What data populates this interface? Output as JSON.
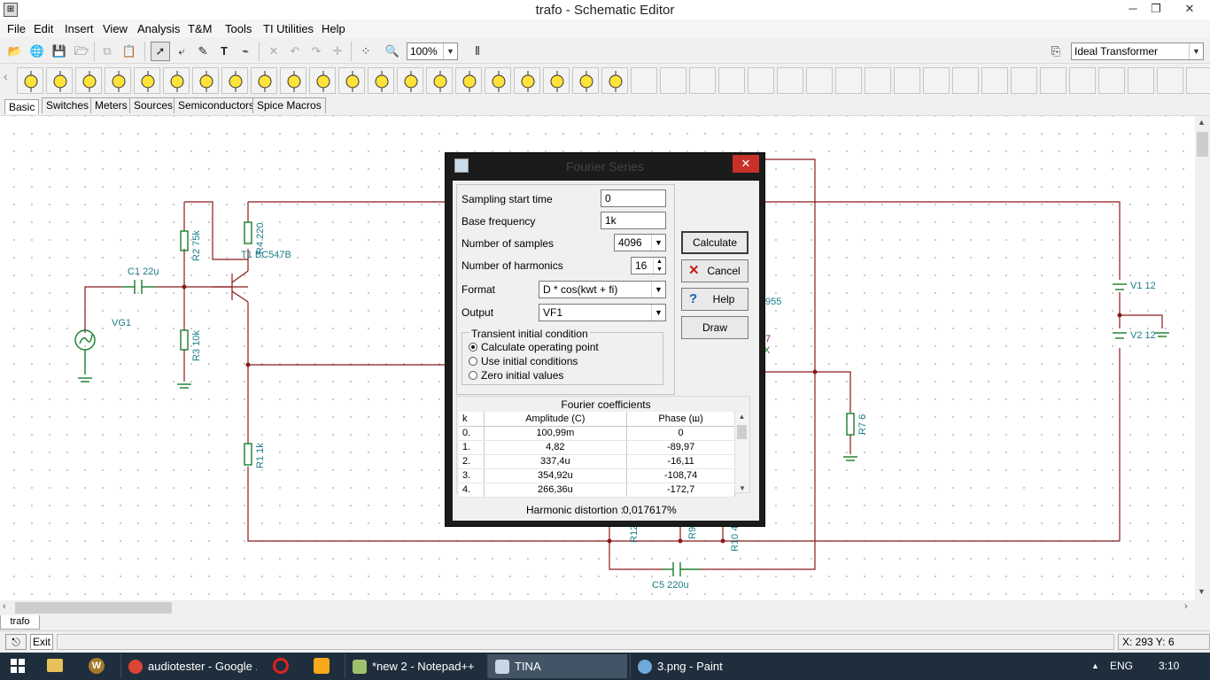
{
  "window": {
    "title": "trafo - Schematic Editor"
  },
  "menu": [
    "File",
    "Edit",
    "Insert",
    "View",
    "Analysis",
    "T&M",
    "Tools",
    "TI Utilities",
    "Help"
  ],
  "toolbar": {
    "zoom": "100%",
    "component_selector": "Ideal Transformer"
  },
  "component_tabs": [
    "Basic",
    "Switches",
    "Meters",
    "Sources",
    "Semiconductors",
    "Spice Macros"
  ],
  "schematic": {
    "labels": {
      "c1": "C1 22u",
      "vg1": "VG1",
      "r2": "R2 75k",
      "r3": "R3 10k",
      "r4": "R4 220",
      "t1": "T1 BC547B",
      "r1": "R1 1k",
      "v1": "V1 12",
      "v2": "V2 12",
      "r7": "R7 6",
      "c5": "C5 220u",
      "r12": "R12",
      "r9": "R9",
      "r10": "R10 4",
      "part_955": "955",
      "part_7": "7",
      "part_x": "X"
    }
  },
  "dialog": {
    "title": "Fourier Series",
    "fields": {
      "sampling_start_time": {
        "label": "Sampling start time",
        "value": "0"
      },
      "base_frequency": {
        "label": "Base frequency",
        "value": "1k"
      },
      "number_of_samples": {
        "label": "Number of samples",
        "value": "4096"
      },
      "number_of_harmonics": {
        "label": "Number of harmonics",
        "value": "16"
      },
      "format": {
        "label": "Format",
        "value": "D * cos(kwt + fi)"
      },
      "output": {
        "label": "Output",
        "value": "VF1"
      }
    },
    "transient_group": {
      "title": "Transient initial condition",
      "options": [
        "Calculate operating point",
        "Use initial conditions",
        "Zero initial values"
      ],
      "selected": "Calculate operating point"
    },
    "buttons": {
      "calculate": "Calculate",
      "cancel": "Cancel",
      "help": "Help",
      "draw": "Draw"
    },
    "coefficients": {
      "title": "Fourier coefficients",
      "headers": [
        "k",
        "Amplitude (C)",
        "Phase (ш)"
      ],
      "rows": [
        {
          "k": "0.",
          "amp": "100,99m",
          "phase": "0"
        },
        {
          "k": "1.",
          "amp": "4,82",
          "phase": "-89,97"
        },
        {
          "k": "2.",
          "amp": "337,4u",
          "phase": "-16,11"
        },
        {
          "k": "3.",
          "amp": "354,92u",
          "phase": "-108,74"
        },
        {
          "k": "4.",
          "amp": "266,36u",
          "phase": "-172,7"
        }
      ]
    },
    "distortion": {
      "label": "Harmonic distortion :",
      "value": "0,017617%"
    }
  },
  "pages": {
    "active": "trafo"
  },
  "status": {
    "exit": "Exit",
    "coords": "X: 293 Y: 6"
  },
  "taskbar": {
    "items": [
      "audiotester - Google ...",
      "*new  2 - Notepad++",
      "TINA",
      "3.png - Paint"
    ],
    "lang": "ENG",
    "time": "3:10"
  }
}
